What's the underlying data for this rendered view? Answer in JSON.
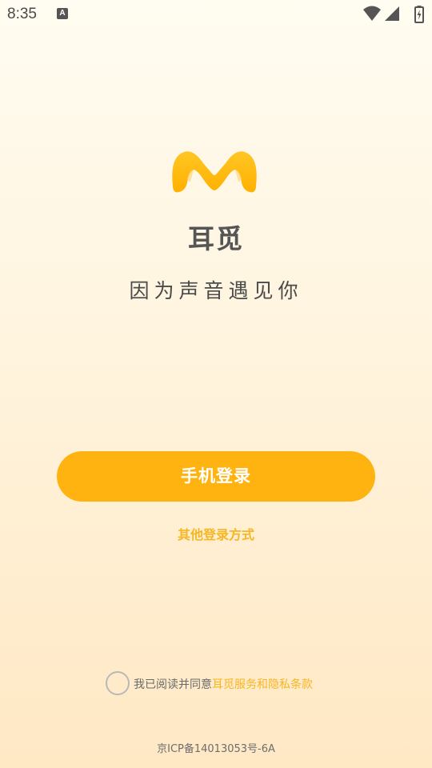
{
  "status_bar": {
    "time": "8:35",
    "notification_icon": "A",
    "icons": [
      "wifi-icon",
      "cell-signal-icon",
      "battery-charging-icon"
    ]
  },
  "branding": {
    "logo_icon": "cat-ears-m-logo",
    "app_name": "耳觅",
    "slogan": "因为声音遇见你"
  },
  "login": {
    "phone_login_label": "手机登录",
    "other_login_label": "其他登录方式"
  },
  "agreement": {
    "checked": false,
    "prefix": "我已阅读并同意",
    "link_label": "耳觅服务和隐私条款"
  },
  "footer": {
    "icp": "京ICP备14013053号-6A"
  },
  "colors": {
    "accent": "#ffb310",
    "link": "#f7b623",
    "background_top": "#fffcf1",
    "background_bottom": "#ffe8c4"
  }
}
